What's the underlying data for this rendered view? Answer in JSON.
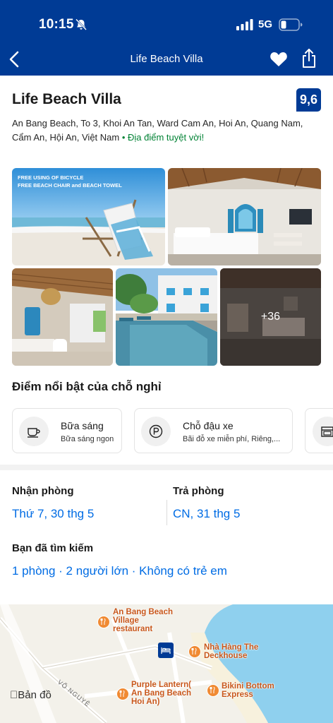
{
  "status_bar": {
    "time": "10:15",
    "network": "5G"
  },
  "nav": {
    "title": "Life Beach Villa"
  },
  "property": {
    "name": "Life Beach Villa",
    "score": "9,6",
    "address": "An Bang Beach, To 3, Khoi An Tan, Ward Cam An, Hoi An, Quang Nam, Cẩm An, Hội An, Việt Nam",
    "location_badge": "• Địa điểm tuyệt vời!"
  },
  "gallery": {
    "promo_line1": "FREE USING OF BICYCLE",
    "promo_line2": "FREE BEACH CHAIR and BEACH TOWEL",
    "more_count": "+36"
  },
  "highlights": {
    "title": "Điểm nổi bật của chỗ nghỉ",
    "items": [
      {
        "title": "Bữa sáng",
        "subtitle": "Bữa sáng ngon",
        "icon": "coffee-cup-icon"
      },
      {
        "title": "Chỗ đậu xe",
        "subtitle": "Bãi đỗ xe miễn phí, Riêng,...",
        "icon": "parking-icon"
      }
    ]
  },
  "booking": {
    "checkin_label": "Nhận phòng",
    "checkin_value": "Thứ 7, 30 thg 5",
    "checkout_label": "Trả phòng",
    "checkout_value": "CN, 31 thg 5",
    "search_label": "Bạn đã tìm kiếm",
    "search_value": "1 phòng · 2 người lớn · Không có trẻ em"
  },
  "map": {
    "pois": {
      "an_bang_line1": "An Bang Beach",
      "an_bang_line2": "Village",
      "an_bang_line3": "restaurant",
      "deckhouse_line1": "Nhà Hàng The",
      "deckhouse_line2": "Deckhouse",
      "purple_line1": "Purple Lantern(",
      "purple_line2": "An Bang Beach",
      "purple_line3": "Hoi An)",
      "bikini_line1": "Bikini Bottom",
      "bikini_line2": "Express"
    },
    "street": "VÕ NGUYÊ",
    "maps_label": "Bản đồ"
  },
  "colors": {
    "brand": "#003b95",
    "link": "#006ce4",
    "success": "#008234"
  }
}
